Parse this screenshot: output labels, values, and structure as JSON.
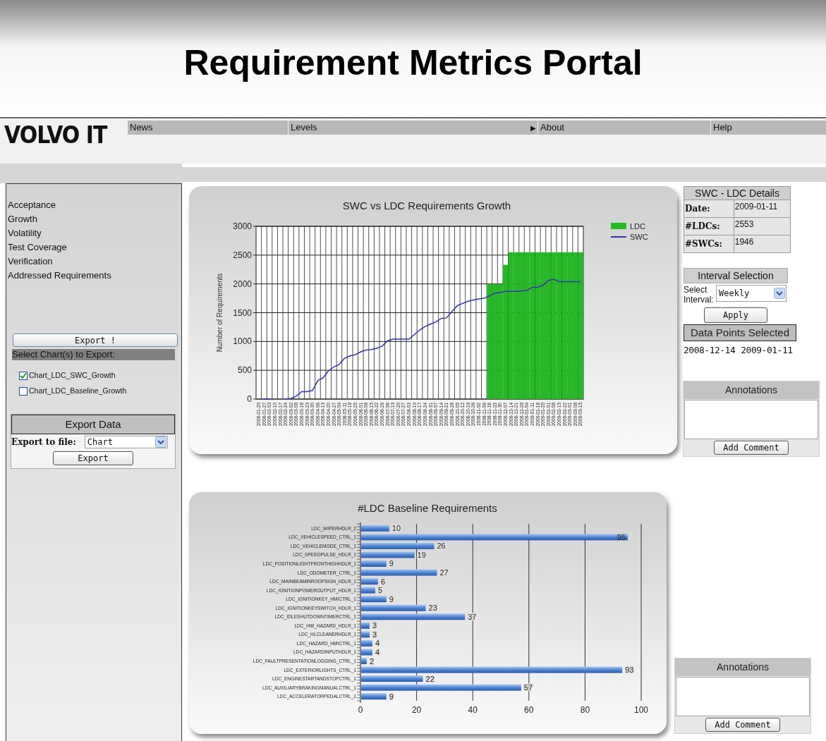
{
  "header": {
    "title": "Requirement Metrics Portal"
  },
  "logo": {
    "text": "VOLVO IT"
  },
  "nav": [
    {
      "label": "News"
    },
    {
      "label": "Levels",
      "submenu_marker": "▶"
    },
    {
      "label": "About"
    },
    {
      "label": "Help"
    }
  ],
  "sidebar": {
    "links": [
      "Acceptance",
      "Growth",
      "Volatility",
      "Test Coverage",
      "Verification",
      "Addressed Requirements"
    ],
    "export_button": "Export !",
    "export_heading": "Select Chart(s) to Export:",
    "charts": [
      {
        "label": "Chart_LDC_SWC_Growth",
        "checked": true
      },
      {
        "label": "Chart_LDC_Baseline_Growth",
        "checked": false
      }
    ],
    "export_data": {
      "title": "Export Data",
      "label": "Export to file:",
      "value": "Chart",
      "button": "Export"
    }
  },
  "growth_chart": {
    "chart_data": {
      "type": "bar",
      "title": "SWC vs LDC Requirements Growth",
      "ylabel": "Number of Requirements",
      "ylim": [
        0,
        3000
      ],
      "stacked": false,
      "grid": true,
      "legend": true,
      "yticks": [
        0,
        500,
        1000,
        1500,
        2000,
        2500,
        3000
      ],
      "categories": [
        "2008-01-20",
        "2008-01-27",
        "2008-02-03",
        "2008-02-10",
        "2008-02-17",
        "2008-02-24",
        "2008-03-02",
        "2008-03-09",
        "2008-03-16",
        "2008-03-23",
        "2008-03-30",
        "2008-04-06",
        "2008-04-13",
        "2008-04-20",
        "2008-04-27",
        "2008-05-04",
        "2008-05-11",
        "2008-05-18",
        "2008-05-25",
        "2008-06-01",
        "2008-06-08",
        "2008-06-15",
        "2008-06-22",
        "2008-06-29",
        "2008-07-06",
        "2008-07-13",
        "2008-07-20",
        "2008-07-27",
        "2008-08-03",
        "2008-08-10",
        "2008-08-17",
        "2008-08-24",
        "2008-08-31",
        "2008-09-07",
        "2008-09-14",
        "2008-09-21",
        "2008-09-28",
        "2008-10-05",
        "2008-10-12",
        "2008-10-19",
        "2008-10-26",
        "2008-11-02",
        "2008-11-09",
        "2008-11-16",
        "2008-11-23",
        "2008-11-30",
        "2008-12-07",
        "2008-12-14",
        "2008-12-21",
        "2008-12-28",
        "2009-01-04",
        "2009-01-11",
        "2009-01-18",
        "2009-01-25",
        "2009-02-01",
        "2009-02-08",
        "2009-02-15",
        "2009-02-22",
        "2009-03-01",
        "2009-03-08",
        "2009-03-15"
      ],
      "series": [
        {
          "name": "LDC",
          "color": "#22bb22",
          "type": "bar",
          "values": [
            null,
            null,
            null,
            null,
            null,
            null,
            null,
            null,
            null,
            null,
            null,
            null,
            null,
            null,
            null,
            null,
            null,
            null,
            null,
            null,
            null,
            null,
            null,
            null,
            null,
            null,
            null,
            null,
            null,
            null,
            null,
            null,
            null,
            null,
            null,
            null,
            null,
            null,
            null,
            null,
            null,
            null,
            null,
            2000,
            2000,
            2000,
            2330,
            2550,
            2550,
            2550,
            2550,
            2550,
            2550,
            2550,
            2550,
            2550,
            2550,
            2550,
            2550,
            2550,
            2550
          ]
        },
        {
          "name": "SWC",
          "color": "#3333aa",
          "type": "line",
          "values": [
            null,
            0,
            0,
            null,
            null,
            0,
            10,
            50,
            130,
            130,
            150,
            320,
            370,
            490,
            560,
            600,
            710,
            750,
            770,
            820,
            850,
            860,
            880,
            920,
            1010,
            1040,
            1040,
            1040,
            1040,
            1120,
            1200,
            1260,
            1300,
            1340,
            1400,
            1410,
            1520,
            1620,
            1660,
            1700,
            1720,
            1740,
            1750,
            1790,
            1840,
            1850,
            1870,
            1870,
            1870,
            1880,
            1890,
            1940,
            1940,
            1980,
            2060,
            2080,
            2040,
            2040,
            2040,
            2040,
            2040
          ]
        }
      ]
    }
  },
  "details": {
    "title": "SWC - LDC Details",
    "rows": [
      {
        "label": "Date:",
        "value": "2009-01-11"
      },
      {
        "label": "#LDCs:",
        "value": "2553"
      },
      {
        "label": "#SWCs:",
        "value": "1946"
      }
    ]
  },
  "interval": {
    "title": "Interval Selection",
    "label": "Select Interval:",
    "value": "Weekly",
    "button": "Apply"
  },
  "data_points": {
    "title": "Data Points Selected",
    "values": [
      "2008-12-14",
      "2009-01-11"
    ]
  },
  "annotations": [
    {
      "title": "Annotations",
      "button": "Add Comment"
    },
    {
      "title": "Annotations",
      "button": "Add Comment"
    }
  ],
  "baseline_chart": {
    "chart_data": {
      "type": "bar",
      "orientation": "horizontal",
      "title": "#LDC Baseline Requirements",
      "xlim": [
        0,
        100
      ],
      "grid": true,
      "xticks": [
        0,
        20,
        40,
        60,
        80,
        100
      ],
      "data_labels": true,
      "categories": [
        "LDC_WIPERHDLR_2",
        "LDC_VEHICLESPEED_CTRL_1",
        "LDC_VEHICLEMODE_CTRL_1",
        "LDC_SPEEDPULSE_HDLR_1",
        "LDC_POSITIONLIGHTFRONTHIGHHDLR_1",
        "LDC_ODOMETER_CTRL_1",
        "LDC_MAINBEAMINROOFSIGN_HDLR_1",
        "LDC_IGNITIONPOWEROUTPUT_HDLR_1",
        "LDC_IGNITIONKEY_HMICTRL_1",
        "LDC_IGNITIONKEYSWITCH_HDLR_1",
        "LDC_IDLESHUTDOWNTIMERCTRL_1",
        "LDC_HW_HAZARD_HDLR_1",
        "LDC_HLCLEANERHDLR_1",
        "LDC_HAZARD_HMICTRL_1",
        "LDC_HAZARDINPUTHDLR_1",
        "LDC_FAULTPRESENTATIONLOGGING_CTRL_1",
        "LDC_EXTERIORLIGHTS_CTRL_1",
        "LDC_ENGINESTARTANDSTOPCTRL_1",
        "LDC_AUXILIARYBRAKINGMANUALCTRL_1",
        "LDC_ACCELERATORPEDALCTRL_1"
      ],
      "values": [
        10,
        95,
        26,
        19,
        9,
        27,
        6,
        5,
        9,
        23,
        37,
        3,
        3,
        4,
        4,
        2,
        93,
        22,
        57,
        9
      ]
    }
  }
}
